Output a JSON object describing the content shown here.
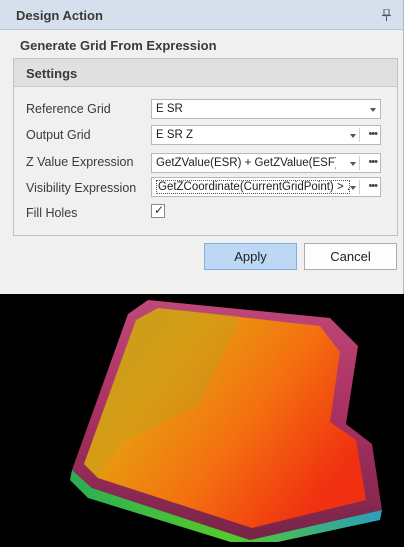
{
  "window": {
    "title": "Design Action"
  },
  "section": {
    "title": "Generate Grid From Expression"
  },
  "settings": {
    "title": "Settings",
    "rows": [
      {
        "label": "Reference Grid",
        "value": "E SR",
        "has_ellipsis": false
      },
      {
        "label": "Output Grid",
        "value": "E SR  Z",
        "has_ellipsis": true
      },
      {
        "label": "Z Value Expression",
        "value": "GetZValue(ESR) + GetZValue(ESF)",
        "has_ellipsis": true
      },
      {
        "label": "Visibility Expression",
        "value": "GetZCoordinate(CurrentGridPoint) > ...",
        "has_ellipsis": true
      }
    ],
    "fill_holes": {
      "label": "Fill Holes",
      "checked": true
    }
  },
  "buttons": {
    "apply": "Apply",
    "cancel": "Cancel"
  },
  "icons": {
    "pin": "pin-icon",
    "dropdown": "chevron-down-icon",
    "ellipsis": "ellipsis-icon"
  },
  "colors": {
    "title_bar": "#d6e0ec",
    "apply_bg": "#bcd8f4",
    "viewport_bg": "#000000"
  }
}
